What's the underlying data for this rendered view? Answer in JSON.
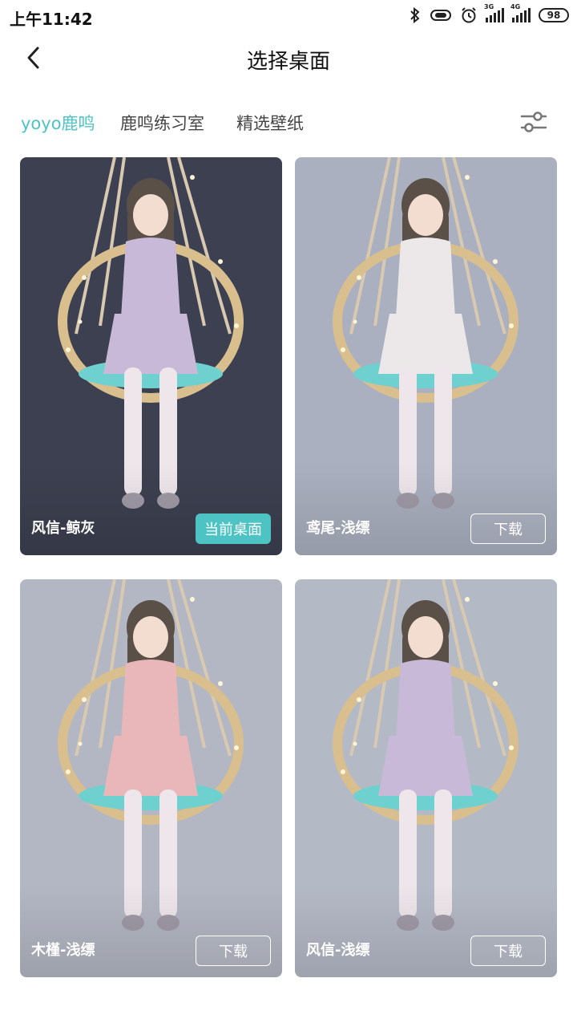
{
  "status": {
    "time": "上午11:42",
    "net1": "3G",
    "net2": "4G",
    "battery": "98"
  },
  "header": {
    "title": "选择桌面"
  },
  "tabs": [
    {
      "label": "yoyo鹿鸣",
      "active": true
    },
    {
      "label": "鹿鸣练习室",
      "active": false
    },
    {
      "label": "精选壁纸",
      "active": false
    }
  ],
  "cards": [
    {
      "name": "风信-鲸灰",
      "button": "当前桌面",
      "button_type": "current",
      "bg": "#3c4050",
      "outfit": "#c9b9d8"
    },
    {
      "name": "鸢尾-浅缥",
      "button": "下载",
      "button_type": "download",
      "bg": "#aab0bf",
      "outfit": "#ece8ea"
    },
    {
      "name": "木槿-浅缥",
      "button": "下载",
      "button_type": "download",
      "bg": "#b3b7c3",
      "outfit": "#e9b7b9"
    },
    {
      "name": "风信-浅缥",
      "button": "下载",
      "button_type": "download",
      "bg": "#b4b9c6",
      "outfit": "#c9b9d8"
    }
  ],
  "colors": {
    "accent": "#4ec3c4"
  }
}
